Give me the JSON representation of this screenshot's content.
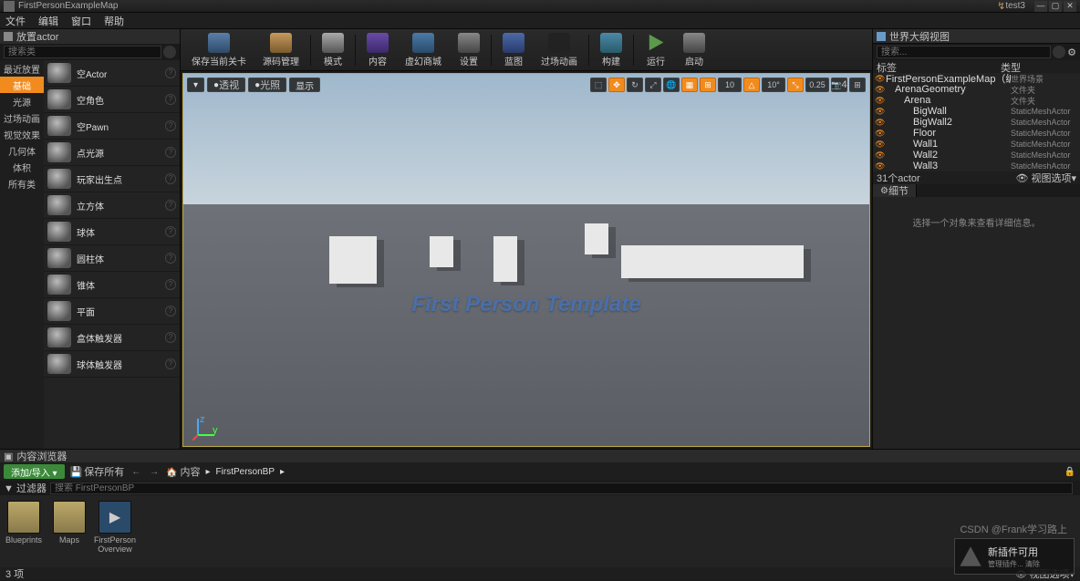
{
  "titlebar": {
    "title": "FirstPersonExampleMap",
    "project": "test3"
  },
  "menubar": [
    "文件",
    "编辑",
    "窗口",
    "帮助"
  ],
  "placeActors": {
    "header": "放置actor",
    "searchPlaceholder": "搜索类",
    "categories": [
      "最近放置",
      "基础",
      "光源",
      "过场动画",
      "视觉效果",
      "几何体",
      "体积",
      "所有类"
    ],
    "selectedCategory": 1,
    "items": [
      {
        "label": "空Actor"
      },
      {
        "label": "空角色"
      },
      {
        "label": "空Pawn"
      },
      {
        "label": "点光源"
      },
      {
        "label": "玩家出生点"
      },
      {
        "label": "立方体"
      },
      {
        "label": "球体"
      },
      {
        "label": "圆柱体"
      },
      {
        "label": "锥体"
      },
      {
        "label": "平面"
      },
      {
        "label": "盒体触发器"
      },
      {
        "label": "球体触发器"
      }
    ]
  },
  "toolbar": {
    "save": "保存当前关卡",
    "source": "源码管理",
    "modes": "模式",
    "content": "内容",
    "market": "虚幻商城",
    "settings": "设置",
    "blueprint": "蓝图",
    "cinematics": "过场动画",
    "build": "构建",
    "play": "运行",
    "launch": "启动"
  },
  "viewport": {
    "left": {
      "dropdown": "▾",
      "perspective": "透视",
      "lit": "光照",
      "show": "显示"
    },
    "right": {
      "grid": "10",
      "angle": "10°",
      "scale": "0.25",
      "cam": "4"
    },
    "floorText": "First Person Template"
  },
  "outliner": {
    "header": "世界大纲视图",
    "searchPlaceholder": "搜索...",
    "cols": {
      "label": "标签",
      "type": "类型"
    },
    "tree": [
      {
        "indent": 0,
        "name": "FirstPersonExampleMap（编辑器）",
        "type": "世界场景"
      },
      {
        "indent": 1,
        "name": "ArenaGeometry",
        "type": "文件夹"
      },
      {
        "indent": 2,
        "name": "Arena",
        "type": "文件夹"
      },
      {
        "indent": 3,
        "name": "BigWall",
        "type": "StaticMeshActor"
      },
      {
        "indent": 3,
        "name": "BigWall2",
        "type": "StaticMeshActor"
      },
      {
        "indent": 3,
        "name": "Floor",
        "type": "StaticMeshActor"
      },
      {
        "indent": 3,
        "name": "Wall1",
        "type": "StaticMeshActor"
      },
      {
        "indent": 3,
        "name": "Wall2",
        "type": "StaticMeshActor"
      },
      {
        "indent": 3,
        "name": "Wall3",
        "type": "StaticMeshActor"
      }
    ],
    "footer": {
      "count": "31个actor",
      "viewOptions": "视图选项▾"
    }
  },
  "details": {
    "header": "细节",
    "empty": "选择一个对象来查看详细信息。"
  },
  "contentBrowser": {
    "header": "内容浏览器",
    "addImport": "添加/导入 ▾",
    "saveAll": "保存所有",
    "pathLabel": "内容",
    "pathSub": "FirstPersonBP",
    "filterLabel": "过滤器",
    "searchPlaceholder": "搜索 FirstPersonBP",
    "assets": [
      {
        "label": "Blueprints",
        "kind": "folder"
      },
      {
        "label": "Maps",
        "kind": "folder"
      },
      {
        "label": "FirstPerson\nOverview",
        "kind": "bp"
      }
    ],
    "footer": "3 项",
    "viewOptions": "视图选项▾"
  },
  "pluginToast": {
    "title": "新插件可用",
    "sub": "管理插件...    清除"
  },
  "watermark": "CSDN @Frank学习路上"
}
